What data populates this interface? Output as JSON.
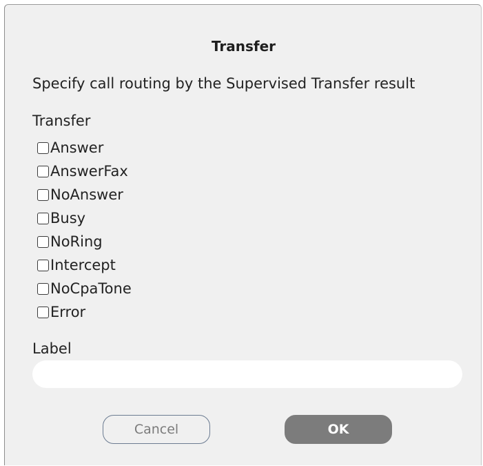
{
  "dialog": {
    "title": "Transfer",
    "description": "Specify call routing by the Supervised Transfer result",
    "group_label": "Transfer",
    "options": [
      {
        "label": "Answer",
        "checked": false
      },
      {
        "label": "AnswerFax",
        "checked": false
      },
      {
        "label": "NoAnswer",
        "checked": false
      },
      {
        "label": "Busy",
        "checked": false
      },
      {
        "label": "NoRing",
        "checked": false
      },
      {
        "label": "Intercept",
        "checked": false
      },
      {
        "label": "NoCpaTone",
        "checked": false
      },
      {
        "label": "Error",
        "checked": false
      }
    ],
    "label_caption": "Label",
    "label_value": "",
    "label_placeholder": "",
    "buttons": {
      "cancel": "Cancel",
      "ok": "OK"
    }
  }
}
